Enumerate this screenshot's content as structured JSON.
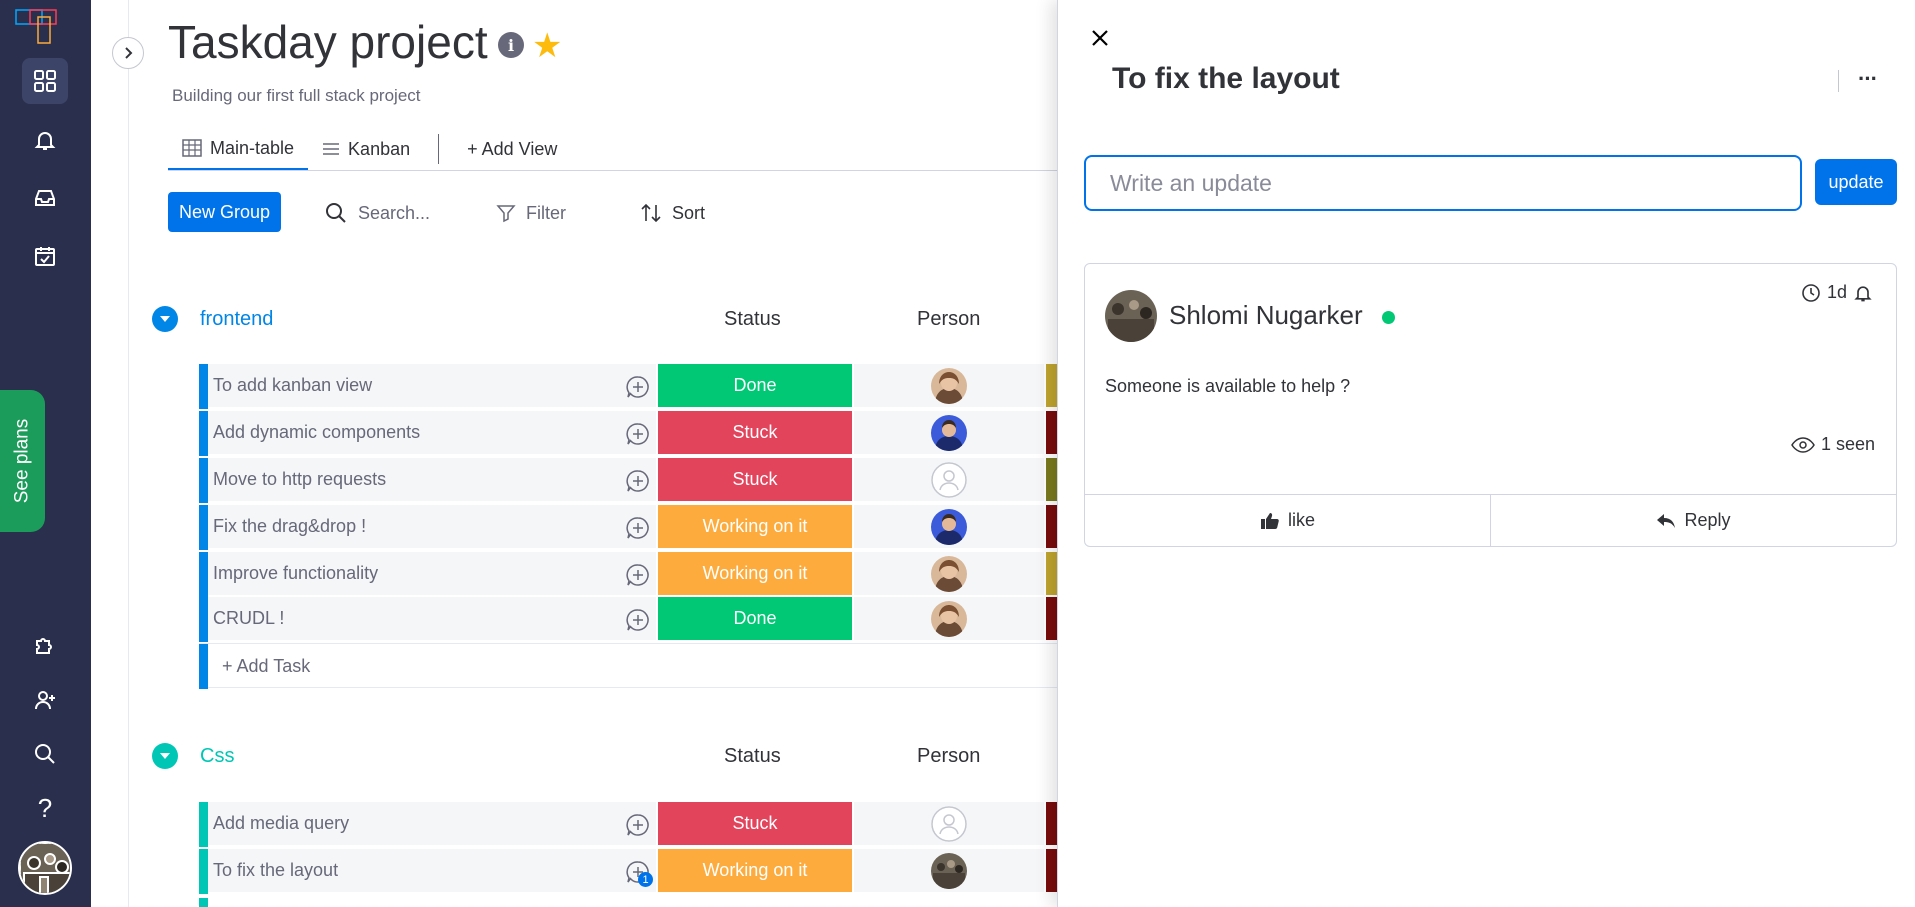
{
  "board": {
    "title": "Taskday project",
    "description": "Building our first full stack project"
  },
  "nav": {
    "see_plans": "See plans"
  },
  "views": {
    "tabs": [
      {
        "label": "Main-table",
        "icon": "table-icon"
      },
      {
        "label": "Kanban",
        "icon": "list-icon"
      }
    ],
    "add_view": "+ Add View"
  },
  "toolbar": {
    "new_group": "New Group",
    "search_placeholder": "Search...",
    "filter": "Filter",
    "sort": "Sort"
  },
  "colors": {
    "done": "#00c875",
    "stuck": "#e2445c",
    "working": "#fdab3d",
    "group_frontend": "#0086e6",
    "group_css": "#00c7b5"
  },
  "groups": [
    {
      "name": "frontend",
      "color": "#0086e6",
      "columns": {
        "status": "Status",
        "person": "Person"
      },
      "add_task": "+ Add Task",
      "tasks": [
        {
          "name": "To add kanban view",
          "status": "Done",
          "status_color": "#00c875",
          "person": "avatar-woman",
          "date_color": "#c0a52e"
        },
        {
          "name": "Add dynamic components",
          "status": "Stuck",
          "status_color": "#e2445c",
          "person": "avatar-man-blue",
          "date_color": "#7a0c0c"
        },
        {
          "name": "Move to http requests",
          "status": "Stuck",
          "status_color": "#e2445c",
          "person": "avatar-empty",
          "date_color": "#7a7a1e"
        },
        {
          "name": "Fix the drag&drop !",
          "status": "Working on it",
          "status_color": "#fdab3d",
          "person": "avatar-man-blue",
          "date_color": "#7a0c0c"
        },
        {
          "name": "Improve functionality",
          "status": "Working on it",
          "status_color": "#fdab3d",
          "person": "avatar-woman",
          "date_color": "#c0a52e"
        },
        {
          "name": "CRUDL !",
          "status": "Done",
          "status_color": "#00c875",
          "person": "avatar-woman",
          "date_color": "#7a0c0c"
        }
      ]
    },
    {
      "name": "Css",
      "color": "#00c7b5",
      "columns": {
        "status": "Status",
        "person": "Person"
      },
      "tasks": [
        {
          "name": "Add media query",
          "status": "Stuck",
          "status_color": "#e2445c",
          "person": "avatar-empty",
          "date_color": "#7a0c0c"
        },
        {
          "name": "To fix the layout",
          "status": "Working on it",
          "status_color": "#fdab3d",
          "person": "avatar-crowd",
          "date_color": "#7a0c0c",
          "updates": "1"
        }
      ]
    }
  ],
  "panel": {
    "title": "To fix the layout",
    "more": "···",
    "update_placeholder": "Write an update",
    "update_button": "update",
    "post": {
      "author": "Shlomi Nugarker",
      "time": "1d",
      "text": "Someone is available to help ?",
      "seen": "1 seen",
      "like": "like",
      "reply": "Reply"
    }
  }
}
